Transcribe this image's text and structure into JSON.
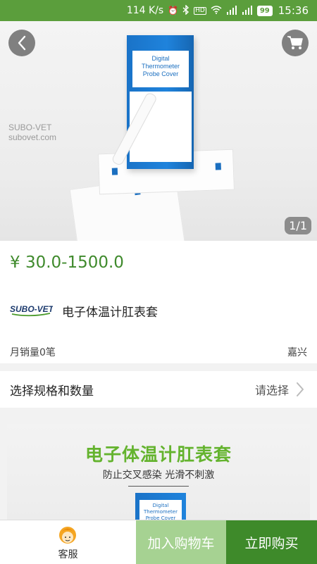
{
  "status_bar": {
    "network_speed": "114 K/s",
    "indicators": [
      "alarm-icon",
      "bluetooth-icon",
      "hd-icon",
      "wifi-icon",
      "signal-4g-icon",
      "signal-3g-icon"
    ],
    "hd_label": "HD",
    "battery": "99",
    "time": "15:36"
  },
  "hero": {
    "watermark_line1": "SUBO-VET",
    "watermark_line2": "subovet.com",
    "box_label": "Digital Thermometer Probe Cover",
    "pager": "1/1"
  },
  "product": {
    "price": "¥ 30.0-1500.0",
    "brand": "SUBO-VET",
    "title": "电子体温计肛表套",
    "sales": "月销量0笔",
    "location": "嘉兴"
  },
  "spec": {
    "label": "选择规格和数量",
    "value": "请选择"
  },
  "detail": {
    "title": "电子体温计肛表套",
    "subtitle": "防止交叉感染  光滑不刺激",
    "box_label": "Digital Thermometer Probe Cover"
  },
  "bottom_bar": {
    "service_label": "客服",
    "add_to_cart": "加入购物车",
    "buy_now": "立即购买"
  },
  "colors": {
    "status_bar": "#5b9e3c",
    "price": "#3f8a2c",
    "add_to_cart_bg": "#a6d292",
    "buy_now_bg": "#3e8a2a",
    "detail_title": "#64b32e"
  }
}
